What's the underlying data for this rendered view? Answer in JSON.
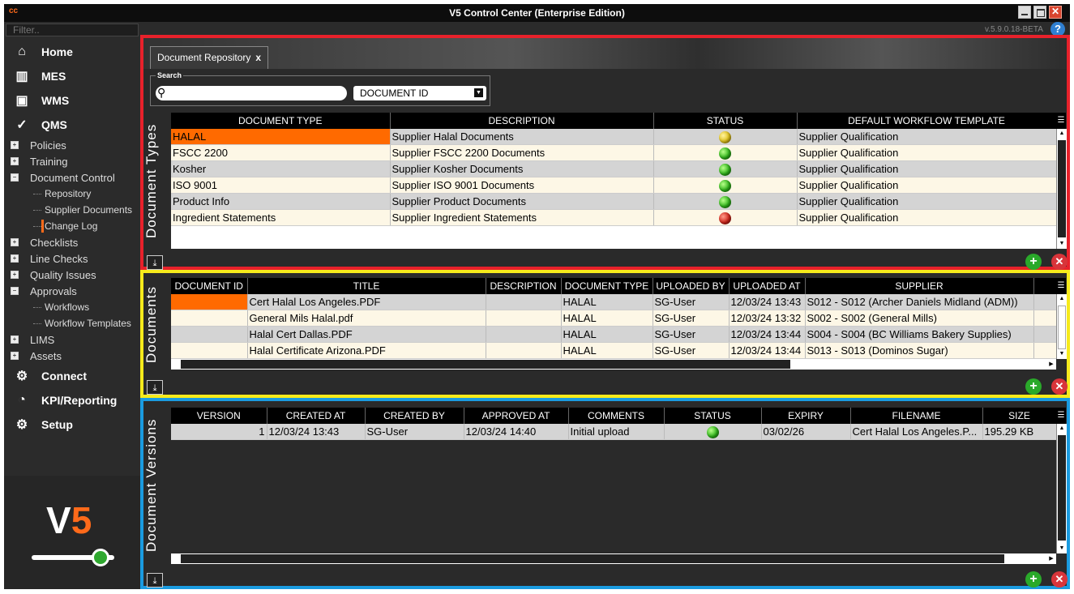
{
  "window": {
    "title": "V5 Control Center (Enterprise Edition)",
    "logo": "cc",
    "version": "v.5.9.0.18-BETA"
  },
  "sidebar": {
    "filter_placeholder": "Filter..",
    "top_items": [
      {
        "label": "Home",
        "icon": "home-icon"
      },
      {
        "label": "MES",
        "icon": "factory-icon"
      },
      {
        "label": "WMS",
        "icon": "box-icon"
      },
      {
        "label": "QMS",
        "icon": "check-circle-icon"
      }
    ],
    "qms_items": [
      {
        "label": "Policies",
        "expanded": false
      },
      {
        "label": "Training",
        "expanded": false
      },
      {
        "label": "Document Control",
        "expanded": true
      },
      {
        "label": "Repository",
        "leaf": true
      },
      {
        "label": "Supplier Documents",
        "leaf": true
      },
      {
        "label": "Change Log",
        "leaf": true,
        "active": true
      },
      {
        "label": "Checklists",
        "expanded": false
      },
      {
        "label": "Line Checks",
        "expanded": false
      },
      {
        "label": "Quality Issues",
        "expanded": false
      },
      {
        "label": "Approvals",
        "expanded": true
      },
      {
        "label": "Workflows",
        "leaf": true
      },
      {
        "label": "Workflow Templates",
        "leaf": true
      },
      {
        "label": "LIMS",
        "expanded": false
      },
      {
        "label": "Assets",
        "expanded": false
      }
    ],
    "bottom_items": [
      {
        "label": "Connect",
        "icon": "api-icon"
      },
      {
        "label": "KPI/Reporting",
        "icon": "pie-chart-icon"
      },
      {
        "label": "Setup",
        "icon": "gears-icon"
      }
    ],
    "brand": {
      "v": "V",
      "five": "5"
    }
  },
  "tab": {
    "label": "Document Repository",
    "close": "x"
  },
  "search": {
    "label": "Search",
    "value": "",
    "field": "DOCUMENT ID"
  },
  "doc_types": {
    "title": "Document Types",
    "columns": [
      "DOCUMENT TYPE",
      "DESCRIPTION",
      "STATUS",
      "DEFAULT WORKFLOW TEMPLATE"
    ],
    "rows": [
      {
        "type": "HALAL",
        "description": "Supplier Halal Documents",
        "status": "yellow",
        "template": "Supplier Qualification"
      },
      {
        "type": "FSCC 2200",
        "description": "Supplier FSCC 2200 Documents",
        "status": "green",
        "template": "Supplier Qualification"
      },
      {
        "type": "Kosher",
        "description": "Supplier Kosher Documents",
        "status": "green",
        "template": "Supplier Qualification"
      },
      {
        "type": "ISO 9001",
        "description": "Supplier ISO 9001 Documents",
        "status": "green",
        "template": "Supplier Qualification"
      },
      {
        "type": "Product Info",
        "description": "Supplier Product Documents",
        "status": "green",
        "template": "Supplier Qualification"
      },
      {
        "type": "Ingredient Statements",
        "description": "Supplier Ingredient Statements",
        "status": "red",
        "template": "Supplier Qualification"
      }
    ]
  },
  "documents": {
    "title": "Documents",
    "columns": [
      "DOCUMENT ID",
      "TITLE",
      "DESCRIPTION",
      "DOCUMENT TYPE",
      "UPLOADED BY",
      "UPLOADED AT",
      "SUPPLIER"
    ],
    "rows": [
      {
        "id": "",
        "title": "Cert Halal Los Angeles.PDF",
        "description": "",
        "type": "HALAL",
        "uploaded_by": "SG-User",
        "uploaded_at": "12/03/24 13:43",
        "supplier": "S012 - S012 (Archer Daniels Midland (ADM))"
      },
      {
        "id": "",
        "title": "General Mils Halal.pdf",
        "description": "",
        "type": "HALAL",
        "uploaded_by": "SG-User",
        "uploaded_at": "12/03/24 13:32",
        "supplier": "S002 - S002 (General Mills)"
      },
      {
        "id": "",
        "title": "Halal Cert Dallas.PDF",
        "description": "",
        "type": "HALAL",
        "uploaded_by": "SG-User",
        "uploaded_at": "12/03/24 13:44",
        "supplier": "S004 - S004 (BC Williams Bakery Supplies)"
      },
      {
        "id": "",
        "title": "Halal Certificate Arizona.PDF",
        "description": "",
        "type": "HALAL",
        "uploaded_by": "SG-User",
        "uploaded_at": "12/03/24 13:44",
        "supplier": "S013 - S013 (Dominos Sugar)"
      }
    ]
  },
  "versions": {
    "title": "Document Versions",
    "columns": [
      "VERSION",
      "CREATED AT",
      "CREATED BY",
      "APPROVED AT",
      "COMMENTS",
      "STATUS",
      "EXPIRY",
      "FILENAME",
      "SIZE"
    ],
    "rows": [
      {
        "version": "1",
        "created_at": "12/03/24 13:43",
        "created_by": "SG-User",
        "approved_at": "12/03/24 14:40",
        "comments": "Initial upload",
        "status": "green",
        "expiry": "03/02/26",
        "filename": "Cert Halal Los Angeles.P...",
        "size": "195.29 KB"
      }
    ]
  },
  "controls": {
    "add": "+",
    "delete": "✕",
    "export": "⤓",
    "help": "?",
    "dropdown": "▼"
  }
}
